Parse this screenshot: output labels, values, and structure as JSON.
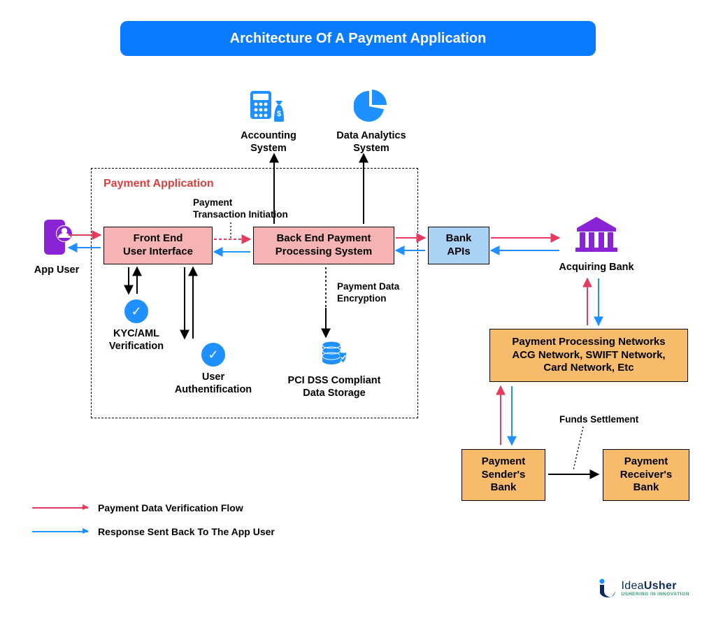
{
  "title": "Architecture Of A Payment Application",
  "container_label": "Payment Application",
  "nodes": {
    "app_user": "App User",
    "front_end": "Front End\nUser Interface",
    "back_end": "Back End Payment\nProcessing System",
    "bank_apis": "Bank\nAPIs",
    "acquiring_bank": "Acquiring Bank",
    "accounting": "Accounting\nSystem",
    "analytics": "Data Analytics\nSystem",
    "kyc": "KYC/AML\nVerification",
    "user_auth": "User\nAuthentification",
    "pci": "PCI DSS Compliant\nData Storage",
    "networks": "Payment Processing Networks\nACG Network, SWIFT Network,\nCard Network, Etc",
    "sender_bank": "Payment\nSender's\nBank",
    "receiver_bank": "Payment\nReceiver's\nBank"
  },
  "edge_labels": {
    "txn_init": "Payment\nTransaction Initiation",
    "encryption": "Payment Data\nEncryption",
    "settlement": "Funds Settlement"
  },
  "legend": {
    "red": "Payment Data Verification Flow",
    "blue": "Response Sent Back To The App User"
  },
  "brand": {
    "name_a": "Idea",
    "name_b": "Usher",
    "tagline": "USHERING IN INNOVATION"
  }
}
